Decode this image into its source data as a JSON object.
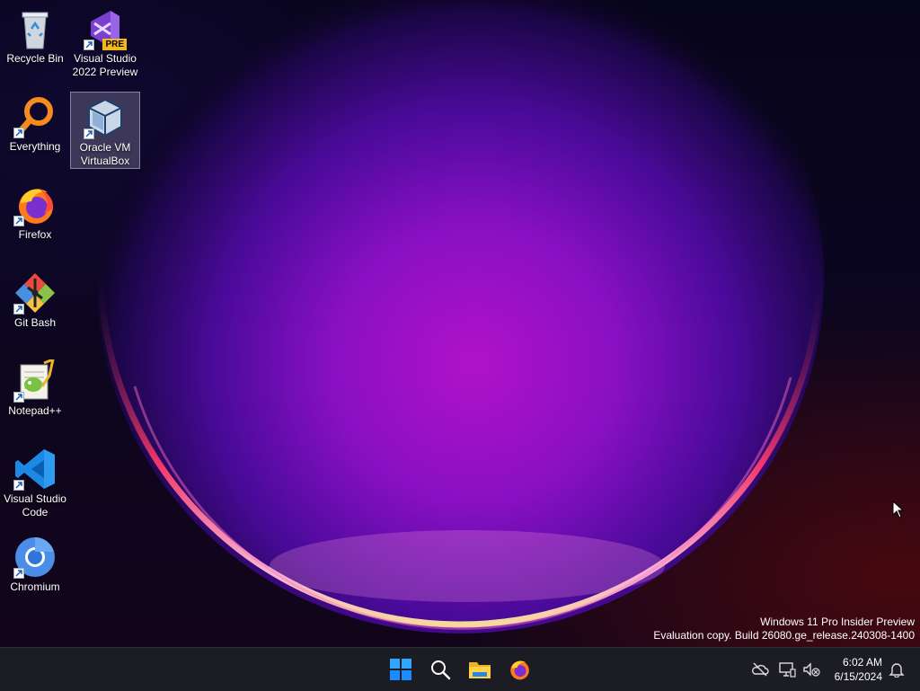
{
  "desktop": {
    "icons": [
      {
        "name": "recycle-bin",
        "label": "Recycle Bin"
      },
      {
        "name": "visual-studio-2022-preview",
        "label": "Visual Studio 2022 Preview",
        "badge": "PRE"
      },
      {
        "name": "everything",
        "label": "Everything"
      },
      {
        "name": "oracle-vm-virtualbox",
        "label": "Oracle VM VirtualBox"
      },
      {
        "name": "firefox",
        "label": "Firefox"
      },
      {
        "name": "git-bash",
        "label": "Git Bash"
      },
      {
        "name": "notepad-plus-plus",
        "label": "Notepad++"
      },
      {
        "name": "visual-studio-code",
        "label": "Visual Studio Code"
      },
      {
        "name": "chromium",
        "label": "Chromium"
      }
    ],
    "selected_icon": "Oracle VM VirtualBox"
  },
  "watermark": {
    "line1": "Windows 11 Pro Insider Preview",
    "line2": "Evaluation copy. Build 26080.ge_release.240308-1400"
  },
  "taskbar": {
    "pinned": [
      "start-icon",
      "search-icon",
      "file-explorer-icon",
      "firefox-icon"
    ],
    "tray": [
      "onedrive-icon",
      "network-icon",
      "volume-muted-icon",
      "notification-bell-icon"
    ],
    "clock": {
      "time": "6:02 AM",
      "date": "6/15/2024"
    }
  },
  "colors": {
    "taskbar_bg": "#1c1c24",
    "wallpaper_accent": "#c21ad0",
    "windows_blue": "#1e90ff"
  }
}
